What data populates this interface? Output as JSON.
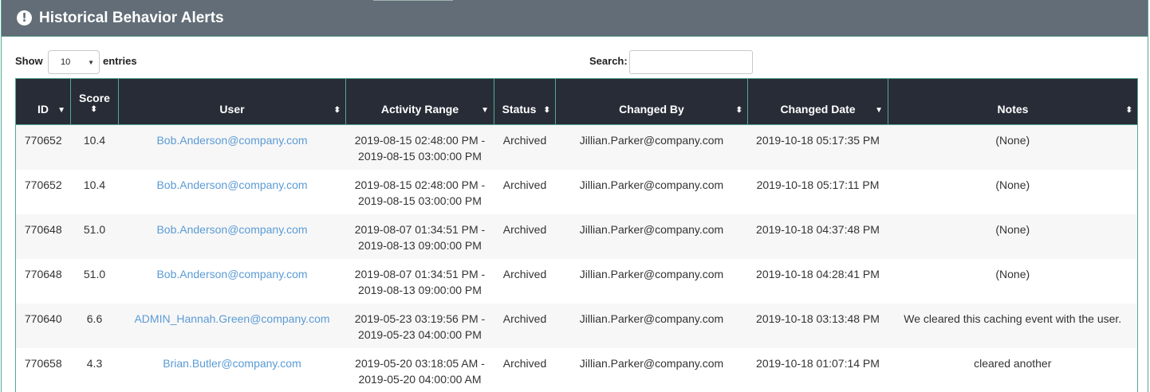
{
  "panel": {
    "title": "Historical Behavior Alerts",
    "icon": "exclamation-circle-icon"
  },
  "controls": {
    "show_label": "Show",
    "entries_label": "entries",
    "page_length": "10",
    "search_label": "Search:",
    "search_value": ""
  },
  "table": {
    "columns": [
      {
        "key": "id",
        "label": "ID",
        "sort": "sort-desc-icon"
      },
      {
        "key": "score",
        "label": "Score",
        "sort": "sort-both-icon"
      },
      {
        "key": "user",
        "label": "User",
        "sort": "sort-both-icon"
      },
      {
        "key": "activity_range",
        "label": "Activity Range",
        "sort": "sort-desc-icon"
      },
      {
        "key": "status",
        "label": "Status",
        "sort": "sort-both-icon"
      },
      {
        "key": "changed_by",
        "label": "Changed By",
        "sort": "sort-both-icon"
      },
      {
        "key": "changed_date",
        "label": "Changed Date",
        "sort": "sort-desc-icon"
      },
      {
        "key": "notes",
        "label": "Notes",
        "sort": "sort-both-icon"
      }
    ],
    "rows": [
      {
        "id": "770652",
        "score": "10.4",
        "user": "Bob.Anderson@company.com",
        "range_start": "2019-08-15 02:48:00 PM -",
        "range_end": "2019-08-15 03:00:00 PM",
        "status": "Archived",
        "changed_by": "Jillian.Parker@company.com",
        "changed_date": "2019-10-18 05:17:35 PM",
        "notes": "(None)"
      },
      {
        "id": "770652",
        "score": "10.4",
        "user": "Bob.Anderson@company.com",
        "range_start": "2019-08-15 02:48:00 PM -",
        "range_end": "2019-08-15 03:00:00 PM",
        "status": "Archived",
        "changed_by": "Jillian.Parker@company.com",
        "changed_date": "2019-10-18 05:17:11 PM",
        "notes": "(None)"
      },
      {
        "id": "770648",
        "score": "51.0",
        "user": "Bob.Anderson@company.com",
        "range_start": "2019-08-07 01:34:51 PM -",
        "range_end": "2019-08-13 09:00:00 PM",
        "status": "Archived",
        "changed_by": "Jillian.Parker@company.com",
        "changed_date": "2019-10-18 04:37:48 PM",
        "notes": "(None)"
      },
      {
        "id": "770648",
        "score": "51.0",
        "user": "Bob.Anderson@company.com",
        "range_start": "2019-08-07 01:34:51 PM -",
        "range_end": "2019-08-13 09:00:00 PM",
        "status": "Archived",
        "changed_by": "Jillian.Parker@company.com",
        "changed_date": "2019-10-18 04:28:41 PM",
        "notes": "(None)"
      },
      {
        "id": "770640",
        "score": "6.6",
        "user": "ADMIN_Hannah.Green@company.com",
        "range_start": "2019-05-23 03:19:56 PM -",
        "range_end": "2019-05-23 04:00:00 PM",
        "status": "Archived",
        "changed_by": "Jillian.Parker@company.com",
        "changed_date": "2019-10-18 03:13:48 PM",
        "notes": "We cleared this caching event with the user."
      },
      {
        "id": "770658",
        "score": "4.3",
        "user": "Brian.Butler@company.com",
        "range_start": "2019-05-20 03:18:05 AM -",
        "range_end": "2019-05-20 04:00:00 AM",
        "status": "Archived",
        "changed_by": "Jillian.Parker@company.com",
        "changed_date": "2019-10-18 01:07:14 PM",
        "notes": "cleared another"
      }
    ]
  },
  "colors": {
    "header_bg": "#626d77",
    "table_header_bg": "#282c37",
    "accent_border": "#55a796",
    "link": "#5b9bd5",
    "row_alt": "#f7f7f7"
  }
}
